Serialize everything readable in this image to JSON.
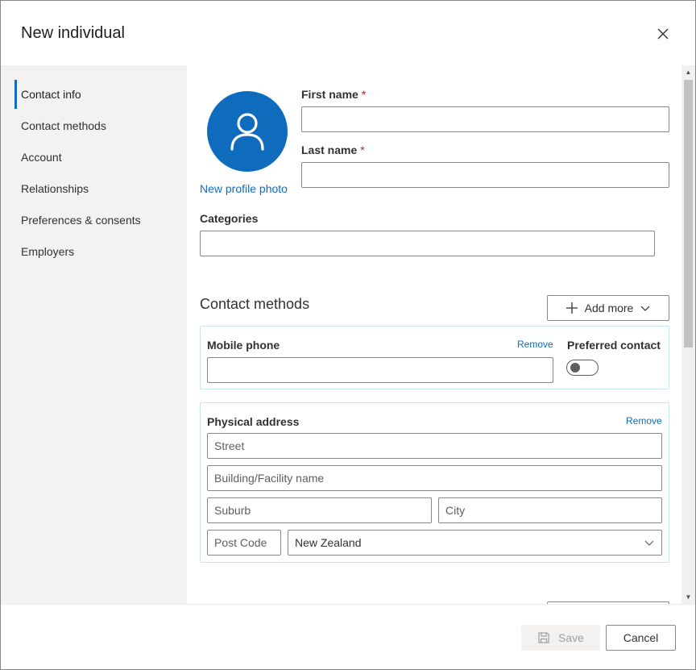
{
  "dialog": {
    "title": "New individual"
  },
  "sidebar": {
    "items": [
      {
        "label": "Contact info"
      },
      {
        "label": "Contact methods"
      },
      {
        "label": "Account"
      },
      {
        "label": "Relationships"
      },
      {
        "label": "Preferences & consents"
      },
      {
        "label": "Employers"
      }
    ]
  },
  "profile": {
    "new_photo_link": "New profile photo"
  },
  "fields": {
    "first_name_label": "First name",
    "first_name_value": "",
    "last_name_label": "Last name",
    "last_name_value": "",
    "required_marker": "*",
    "categories_label": "Categories",
    "categories_value": ""
  },
  "contact_methods": {
    "title": "Contact methods",
    "add_more_label": "Add more",
    "mobile": {
      "label": "Mobile phone",
      "remove_label": "Remove",
      "value": "",
      "preferred_label": "Preferred contact",
      "preferred_on": false
    },
    "address": {
      "label": "Physical address",
      "remove_label": "Remove",
      "street_placeholder": "Street",
      "building_placeholder": "Building/Facility name",
      "suburb_placeholder": "Suburb",
      "city_placeholder": "City",
      "postcode_placeholder": "Post Code",
      "country_value": "New Zealand"
    }
  },
  "footer": {
    "save_label": "Save",
    "cancel_label": "Cancel"
  },
  "colors": {
    "accent": "#0f6cbd",
    "sidebar_bg": "#f3f2f1",
    "card_border": "#c8e6ed",
    "required": "#a4262c"
  }
}
